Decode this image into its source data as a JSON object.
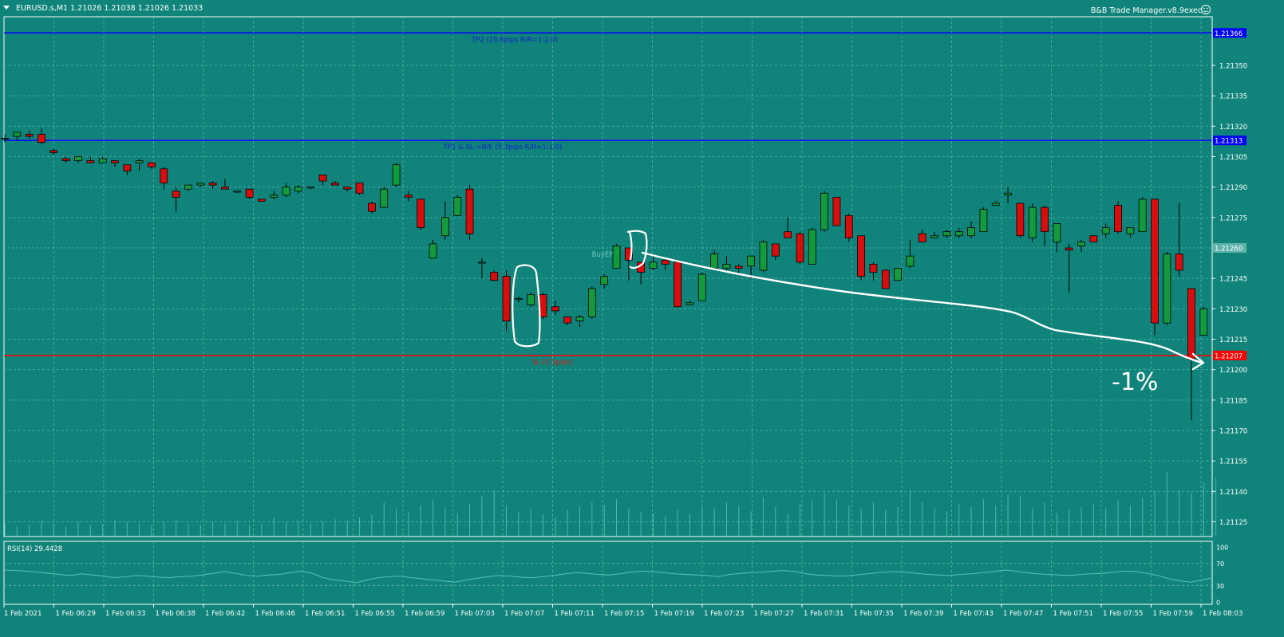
{
  "header": {
    "symbol_line": "EURUSD.s,M1  1.21026 1.21038 1.21026 1.21033",
    "ea_name": "B&B Trade Manager.v8.9exec",
    "ea_icon": "smiley-icon"
  },
  "colors": {
    "background": "#10837a",
    "grid": "#5fb3ab",
    "bull": "#129a3c",
    "bear": "#d80d0d",
    "candle_outline": "#000000",
    "tp_line": "#0000ff",
    "sl_line": "#ff0000",
    "volume": "#4fc7bd",
    "rsi_line": "#5ec2ba",
    "annotation": "#ffffff"
  },
  "levels": {
    "tp2": {
      "price": 1.21366,
      "label": "TP2 (10.6pips R/R=1:2.0)",
      "tag": "1.21366"
    },
    "tp1": {
      "price": 1.21313,
      "label": "TP1 & SL->B/E (5.3pips R/R=1:1.0)",
      "tag": "1.21313"
    },
    "entry": {
      "price": 1.2126,
      "label": "BuyEP",
      "tag": "1.21260"
    },
    "sl": {
      "price": 1.21207,
      "label": "SL (5.3pips)",
      "tag": "1.21207"
    }
  },
  "annotation_text": "-1%",
  "rsi": {
    "label": "RSI(14) 29.4428",
    "axis_labels": [
      "100",
      "70",
      "30",
      "0"
    ],
    "levels": [
      100,
      70,
      30,
      0
    ],
    "values": [
      58,
      57,
      56,
      54,
      52,
      50,
      48,
      51,
      49,
      47,
      44,
      46,
      48,
      47,
      45,
      44,
      46,
      47,
      49,
      52,
      55,
      52,
      48,
      47,
      49,
      50,
      53,
      56,
      52,
      44,
      40,
      38,
      35,
      40,
      44,
      46,
      47,
      44,
      42,
      40,
      38,
      36,
      40,
      43,
      46,
      48,
      47,
      45,
      44,
      46,
      48,
      51,
      53,
      52,
      50,
      49,
      51,
      54,
      56,
      55,
      53,
      51,
      50,
      49,
      48,
      46,
      50,
      52,
      53,
      54,
      56,
      57,
      55,
      51,
      49,
      48,
      47,
      48,
      50,
      52,
      54,
      55,
      54,
      52,
      50,
      49,
      48,
      50,
      51,
      53,
      55,
      58,
      56,
      53,
      51,
      50,
      49,
      48,
      50,
      51,
      52,
      54,
      56,
      55,
      52,
      48,
      42,
      38,
      36,
      40,
      44
    ]
  },
  "chart_data": {
    "type": "candlestick",
    "symbol": "EURUSD.s",
    "timeframe": "M1",
    "y_axis_labels": [
      "1.21350",
      "1.21335",
      "1.21320",
      "1.21305",
      "1.21290",
      "1.21275",
      "1.21245",
      "1.21230",
      "1.21215",
      "1.21200",
      "1.21185",
      "1.21170",
      "1.21155",
      "1.21140",
      "1.21125"
    ],
    "x_axis_labels": [
      "1 Feb 2021",
      "1 Feb 06:29",
      "1 Feb 06:33",
      "1 Feb 06:38",
      "1 Feb 06:42",
      "1 Feb 06:46",
      "1 Feb 06:51",
      "1 Feb 06:55",
      "1 Feb 06:59",
      "1 Feb 07:03",
      "1 Feb 07:07",
      "1 Feb 07:11",
      "1 Feb 07:15",
      "1 Feb 07:19",
      "1 Feb 07:23",
      "1 Feb 07:27",
      "1 Feb 07:31",
      "1 Feb 07:35",
      "1 Feb 07:39",
      "1 Feb 07:43",
      "1 Feb 07:47",
      "1 Feb 07:51",
      "1 Feb 07:55",
      "1 Feb 07:59",
      "1 Feb 08:03"
    ],
    "candles": [
      {
        "o": 1.21314,
        "h": 1.21316,
        "l": 1.21312,
        "c": 1.21314
      },
      {
        "o": 1.21315,
        "h": 1.21317,
        "l": 1.21313,
        "c": 1.21317
      },
      {
        "o": 1.21316,
        "h": 1.21318,
        "l": 1.21314,
        "c": 1.21315
      },
      {
        "o": 1.21316,
        "h": 1.21319,
        "l": 1.21311,
        "c": 1.21312
      },
      {
        "o": 1.21308,
        "h": 1.21309,
        "l": 1.21306,
        "c": 1.21307
      },
      {
        "o": 1.21304,
        "h": 1.21305,
        "l": 1.21302,
        "c": 1.21303
      },
      {
        "o": 1.21303,
        "h": 1.21305,
        "l": 1.21302,
        "c": 1.21305
      },
      {
        "o": 1.21303,
        "h": 1.21305,
        "l": 1.21302,
        "c": 1.21302
      },
      {
        "o": 1.21302,
        "h": 1.21305,
        "l": 1.21302,
        "c": 1.21304
      },
      {
        "o": 1.21303,
        "h": 1.21303,
        "l": 1.213,
        "c": 1.21302
      },
      {
        "o": 1.21301,
        "h": 1.21301,
        "l": 1.21296,
        "c": 1.21298
      },
      {
        "o": 1.21302,
        "h": 1.21304,
        "l": 1.21298,
        "c": 1.21303
      },
      {
        "o": 1.21302,
        "h": 1.21302,
        "l": 1.21299,
        "c": 1.213
      },
      {
        "o": 1.21299,
        "h": 1.213,
        "l": 1.21289,
        "c": 1.21292
      },
      {
        "o": 1.21288,
        "h": 1.2129,
        "l": 1.21278,
        "c": 1.21285
      },
      {
        "o": 1.21289,
        "h": 1.21291,
        "l": 1.21288,
        "c": 1.21291
      },
      {
        "o": 1.21291,
        "h": 1.21292,
        "l": 1.2129,
        "c": 1.21292
      },
      {
        "o": 1.21292,
        "h": 1.21293,
        "l": 1.21289,
        "c": 1.21291
      },
      {
        "o": 1.2129,
        "h": 1.21294,
        "l": 1.21289,
        "c": 1.21289
      },
      {
        "o": 1.21288,
        "h": 1.21288,
        "l": 1.21287,
        "c": 1.21288
      },
      {
        "o": 1.21289,
        "h": 1.21289,
        "l": 1.21284,
        "c": 1.21285
      },
      {
        "o": 1.21284,
        "h": 1.21284,
        "l": 1.21283,
        "c": 1.21283
      },
      {
        "o": 1.21285,
        "h": 1.21288,
        "l": 1.21284,
        "c": 1.21286
      },
      {
        "o": 1.21286,
        "h": 1.21292,
        "l": 1.21285,
        "c": 1.2129
      },
      {
        "o": 1.21288,
        "h": 1.21291,
        "l": 1.21287,
        "c": 1.2129
      },
      {
        "o": 1.2129,
        "h": 1.2129,
        "l": 1.21289,
        "c": 1.2129
      },
      {
        "o": 1.21296,
        "h": 1.21296,
        "l": 1.21291,
        "c": 1.21293
      },
      {
        "o": 1.21292,
        "h": 1.21293,
        "l": 1.21291,
        "c": 1.21291
      },
      {
        "o": 1.2129,
        "h": 1.2129,
        "l": 1.21288,
        "c": 1.21289
      },
      {
        "o": 1.21292,
        "h": 1.21292,
        "l": 1.21286,
        "c": 1.21287
      },
      {
        "o": 1.21282,
        "h": 1.21283,
        "l": 1.21277,
        "c": 1.21278
      },
      {
        "o": 1.2128,
        "h": 1.2129,
        "l": 1.2128,
        "c": 1.21289
      },
      {
        "o": 1.21291,
        "h": 1.21302,
        "l": 1.2129,
        "c": 1.21301
      },
      {
        "o": 1.21286,
        "h": 1.21288,
        "l": 1.21283,
        "c": 1.21285
      },
      {
        "o": 1.21284,
        "h": 1.21284,
        "l": 1.21269,
        "c": 1.2127
      },
      {
        "o": 1.21255,
        "h": 1.21264,
        "l": 1.21255,
        "c": 1.21262
      },
      {
        "o": 1.21266,
        "h": 1.21283,
        "l": 1.21264,
        "c": 1.21275
      },
      {
        "o": 1.21276,
        "h": 1.21286,
        "l": 1.21276,
        "c": 1.21285
      },
      {
        "o": 1.21289,
        "h": 1.21291,
        "l": 1.21264,
        "c": 1.21267
      },
      {
        "o": 1.21253,
        "h": 1.21255,
        "l": 1.21245,
        "c": 1.21253
      },
      {
        "o": 1.21248,
        "h": 1.21249,
        "l": 1.21244,
        "c": 1.21244
      },
      {
        "o": 1.21246,
        "h": 1.21249,
        "l": 1.21219,
        "c": 1.21224
      },
      {
        "o": 1.21235,
        "h": 1.21236,
        "l": 1.21233,
        "c": 1.21235
      },
      {
        "o": 1.21232,
        "h": 1.21238,
        "l": 1.21231,
        "c": 1.21237
      },
      {
        "o": 1.21237,
        "h": 1.21238,
        "l": 1.21225,
        "c": 1.21226
      },
      {
        "o": 1.21231,
        "h": 1.21234,
        "l": 1.21227,
        "c": 1.21229
      },
      {
        "o": 1.21226,
        "h": 1.21226,
        "l": 1.21222,
        "c": 1.21223
      },
      {
        "o": 1.21224,
        "h": 1.21227,
        "l": 1.21221,
        "c": 1.21226
      },
      {
        "o": 1.21226,
        "h": 1.21241,
        "l": 1.21225,
        "c": 1.2124
      },
      {
        "o": 1.21242,
        "h": 1.21247,
        "l": 1.2124,
        "c": 1.21246
      },
      {
        "o": 1.2125,
        "h": 1.21262,
        "l": 1.2125,
        "c": 1.21261
      },
      {
        "o": 1.2126,
        "h": 1.2126,
        "l": 1.21244,
        "c": 1.21254
      },
      {
        "o": 1.21253,
        "h": 1.21253,
        "l": 1.21242,
        "c": 1.21248
      },
      {
        "o": 1.2125,
        "h": 1.21256,
        "l": 1.21249,
        "c": 1.21253
      },
      {
        "o": 1.21254,
        "h": 1.21254,
        "l": 1.21249,
        "c": 1.21252
      },
      {
        "o": 1.21253,
        "h": 1.21253,
        "l": 1.21231,
        "c": 1.21231
      },
      {
        "o": 1.21232,
        "h": 1.21234,
        "l": 1.21232,
        "c": 1.21233
      },
      {
        "o": 1.21234,
        "h": 1.21248,
        "l": 1.21234,
        "c": 1.21247
      },
      {
        "o": 1.2125,
        "h": 1.21259,
        "l": 1.21249,
        "c": 1.21257
      },
      {
        "o": 1.2125,
        "h": 1.21256,
        "l": 1.21248,
        "c": 1.21252
      },
      {
        "o": 1.21251,
        "h": 1.21252,
        "l": 1.21247,
        "c": 1.2125
      },
      {
        "o": 1.21251,
        "h": 1.21256,
        "l": 1.21245,
        "c": 1.21256
      },
      {
        "o": 1.21249,
        "h": 1.21264,
        "l": 1.21248,
        "c": 1.21263
      },
      {
        "o": 1.21262,
        "h": 1.21262,
        "l": 1.21254,
        "c": 1.21256
      },
      {
        "o": 1.21268,
        "h": 1.21275,
        "l": 1.21265,
        "c": 1.21265
      },
      {
        "o": 1.21267,
        "h": 1.21268,
        "l": 1.21252,
        "c": 1.21253
      },
      {
        "o": 1.21252,
        "h": 1.2127,
        "l": 1.21252,
        "c": 1.21269
      },
      {
        "o": 1.21269,
        "h": 1.21288,
        "l": 1.21268,
        "c": 1.21287
      },
      {
        "o": 1.21285,
        "h": 1.21285,
        "l": 1.21271,
        "c": 1.21271
      },
      {
        "o": 1.21276,
        "h": 1.21277,
        "l": 1.21263,
        "c": 1.21265
      },
      {
        "o": 1.21266,
        "h": 1.21266,
        "l": 1.21244,
        "c": 1.21246
      },
      {
        "o": 1.21252,
        "h": 1.21253,
        "l": 1.21244,
        "c": 1.21248
      },
      {
        "o": 1.21249,
        "h": 1.21249,
        "l": 1.2124,
        "c": 1.2124
      },
      {
        "o": 1.21244,
        "h": 1.2125,
        "l": 1.21244,
        "c": 1.2125
      },
      {
        "o": 1.21251,
        "h": 1.21264,
        "l": 1.2125,
        "c": 1.21256
      },
      {
        "o": 1.21267,
        "h": 1.21269,
        "l": 1.21263,
        "c": 1.21263
      },
      {
        "o": 1.21265,
        "h": 1.21268,
        "l": 1.21265,
        "c": 1.21266
      },
      {
        "o": 1.21266,
        "h": 1.21269,
        "l": 1.21265,
        "c": 1.21268
      },
      {
        "o": 1.21266,
        "h": 1.2127,
        "l": 1.21265,
        "c": 1.21268
      },
      {
        "o": 1.21266,
        "h": 1.21273,
        "l": 1.21265,
        "c": 1.2127
      },
      {
        "o": 1.21268,
        "h": 1.2128,
        "l": 1.21268,
        "c": 1.21279
      },
      {
        "o": 1.21281,
        "h": 1.21283,
        "l": 1.21281,
        "c": 1.21282
      },
      {
        "o": 1.21286,
        "h": 1.2129,
        "l": 1.21282,
        "c": 1.21287
      },
      {
        "o": 1.21282,
        "h": 1.21282,
        "l": 1.21265,
        "c": 1.21266
      },
      {
        "o": 1.21265,
        "h": 1.21282,
        "l": 1.21263,
        "c": 1.2128
      },
      {
        "o": 1.2128,
        "h": 1.21281,
        "l": 1.21261,
        "c": 1.21268
      },
      {
        "o": 1.21263,
        "h": 1.21272,
        "l": 1.21258,
        "c": 1.21272
      },
      {
        "o": 1.2126,
        "h": 1.21262,
        "l": 1.21238,
        "c": 1.21259
      },
      {
        "o": 1.21261,
        "h": 1.21264,
        "l": 1.21258,
        "c": 1.21263
      },
      {
        "o": 1.21266,
        "h": 1.21266,
        "l": 1.21263,
        "c": 1.21263
      },
      {
        "o": 1.21267,
        "h": 1.21272,
        "l": 1.21265,
        "c": 1.2127
      },
      {
        "o": 1.21281,
        "h": 1.21283,
        "l": 1.21267,
        "c": 1.21268
      },
      {
        "o": 1.21267,
        "h": 1.2127,
        "l": 1.21265,
        "c": 1.2127
      },
      {
        "o": 1.21268,
        "h": 1.21285,
        "l": 1.21268,
        "c": 1.21284
      },
      {
        "o": 1.21284,
        "h": 1.21284,
        "l": 1.21217,
        "c": 1.21223
      },
      {
        "o": 1.21223,
        "h": 1.21258,
        "l": 1.21222,
        "c": 1.21257
      },
      {
        "o": 1.21257,
        "h": 1.21282,
        "l": 1.21246,
        "c": 1.21249
      },
      {
        "o": 1.2124,
        "h": 1.2124,
        "l": 1.21175,
        "c": 1.21205
      },
      {
        "o": 1.21217,
        "h": 1.21231,
        "l": 1.21217,
        "c": 1.2123
      }
    ],
    "volumes": [
      8,
      6,
      7,
      10,
      8,
      6,
      9,
      7,
      8,
      10,
      9,
      8,
      7,
      9,
      11,
      8,
      7,
      9,
      8,
      10,
      7,
      8,
      12,
      9,
      10,
      8,
      9,
      11,
      10,
      12,
      14,
      22,
      18,
      16,
      20,
      24,
      19,
      15,
      21,
      26,
      30,
      20,
      16,
      18,
      14,
      12,
      17,
      19,
      22,
      20,
      24,
      18,
      16,
      15,
      13,
      17,
      14,
      19,
      18,
      22,
      20,
      16,
      25,
      19,
      14,
      21,
      23,
      28,
      24,
      20,
      18,
      22,
      17,
      19,
      30,
      22,
      18,
      16,
      21,
      19,
      24,
      20,
      27,
      26,
      18,
      22,
      15,
      17,
      19,
      21,
      18,
      23,
      20,
      25,
      29,
      42,
      30,
      28,
      35,
      38
    ]
  }
}
